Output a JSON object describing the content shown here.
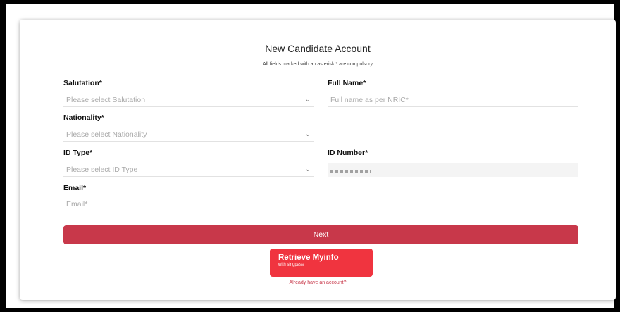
{
  "form": {
    "title": "New Candidate Account",
    "subtitle": "All fields marked with an asterisk * are compulsory",
    "salutation": {
      "label": "Salutation*",
      "placeholder": "Please select Salutation"
    },
    "full_name": {
      "label": "Full Name*",
      "placeholder": "Full name as per NRIC*"
    },
    "nationality": {
      "label": "Nationality*",
      "placeholder": "Please select Nationality"
    },
    "id_type": {
      "label": "ID Type*",
      "placeholder": "Please select ID Type"
    },
    "id_number": {
      "label": "ID Number*"
    },
    "email": {
      "label": "Email*",
      "placeholder": "Email*"
    }
  },
  "actions": {
    "next_label": "Next",
    "myinfo_label": "Retrieve Myinfo",
    "myinfo_sub": "with singpass",
    "already_account": "Already have an account?"
  },
  "colors": {
    "next_button": "#c8384a",
    "myinfo_button": "#f0343f"
  },
  "icons": {
    "select_chevron": "chevron-down-icon"
  }
}
